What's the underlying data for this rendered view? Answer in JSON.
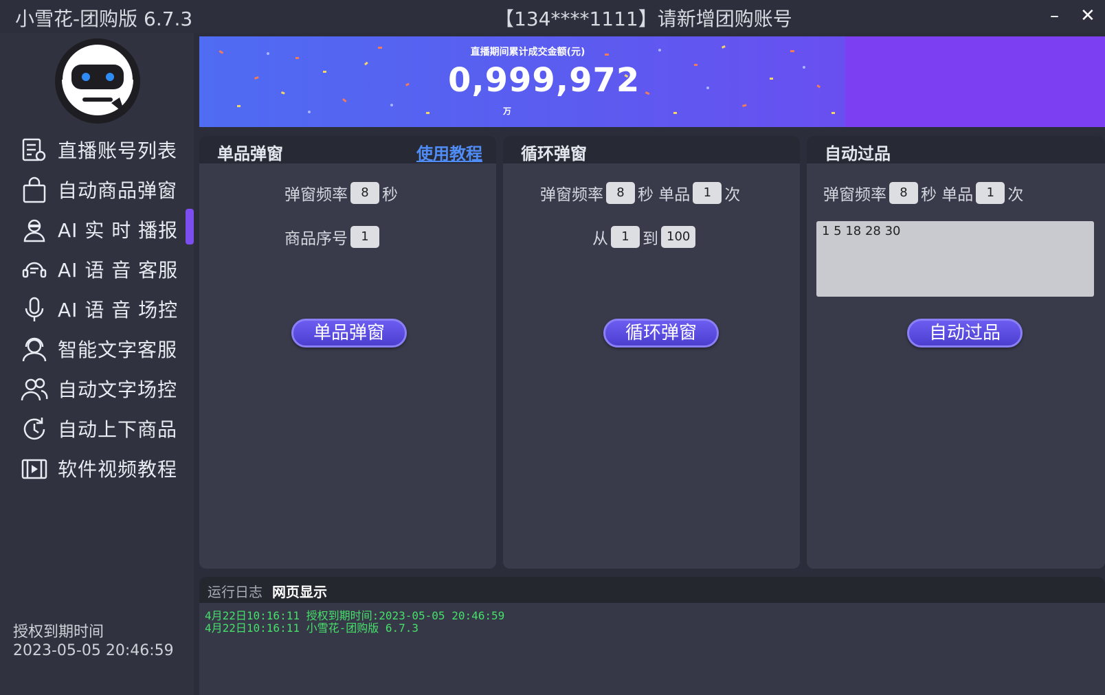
{
  "window": {
    "app_title": "小雪花-团购版 6.7.3",
    "account_title": "【134****1111】请新增团购账号",
    "minimize": "–",
    "close": "✕"
  },
  "sidebar": {
    "items": [
      {
        "label": "直播账号列表",
        "icon": "account-list-icon"
      },
      {
        "label": "自动商品弹窗",
        "icon": "shopping-bag-icon",
        "active": true
      },
      {
        "label": "AI 实 时 播报",
        "icon": "announcer-icon"
      },
      {
        "label": "AI 语 音 客服",
        "icon": "voice-service-icon"
      },
      {
        "label": "AI 语 音 场控",
        "icon": "microphone-icon"
      },
      {
        "label": "智能文字客服",
        "icon": "headset-user-icon"
      },
      {
        "label": "自动文字场控",
        "icon": "users-icon"
      },
      {
        "label": "自动上下商品",
        "icon": "refresh-clock-icon"
      },
      {
        "label": "软件视频教程",
        "icon": "video-icon"
      }
    ],
    "expiry_label": "授权到期时间",
    "expiry_value": "2023-05-05 20:46:59",
    "accent": "#7c4ef0"
  },
  "banner": {
    "caption": "直播期间累计成交金额(元)",
    "amount": "0,999,972",
    "unit": "万"
  },
  "panels": {
    "single": {
      "title": "单品弹窗",
      "link": "使用教程",
      "freq_label": "弹窗频率",
      "freq_value": "8",
      "freq_unit": "秒",
      "seq_label": "商品序号",
      "seq_value": "1",
      "button": "单品弹窗"
    },
    "loop": {
      "title": "循环弹窗",
      "freq_label": "弹窗频率",
      "freq_value": "8",
      "freq_unit": "秒 单品",
      "count_value": "1",
      "count_unit": "次",
      "from_label": "从",
      "from_value": "1",
      "to_label": "到",
      "to_value": "100",
      "button": "循环弹窗"
    },
    "auto": {
      "title": "自动过品",
      "freq_label": "弹窗频率",
      "freq_value": "8",
      "freq_unit": "秒 单品",
      "count_value": "1",
      "count_unit": "次",
      "list_value": "1 5 18 28 30",
      "button": "自动过品"
    }
  },
  "log": {
    "tab_log": "运行日志",
    "tab_web": "网页显示",
    "lines": [
      "4月22日10:16:11 授权到期时间:2023-05-05 20:46:59",
      "4月22日10:16:11 小雪花-团购版 6.7.3"
    ]
  }
}
